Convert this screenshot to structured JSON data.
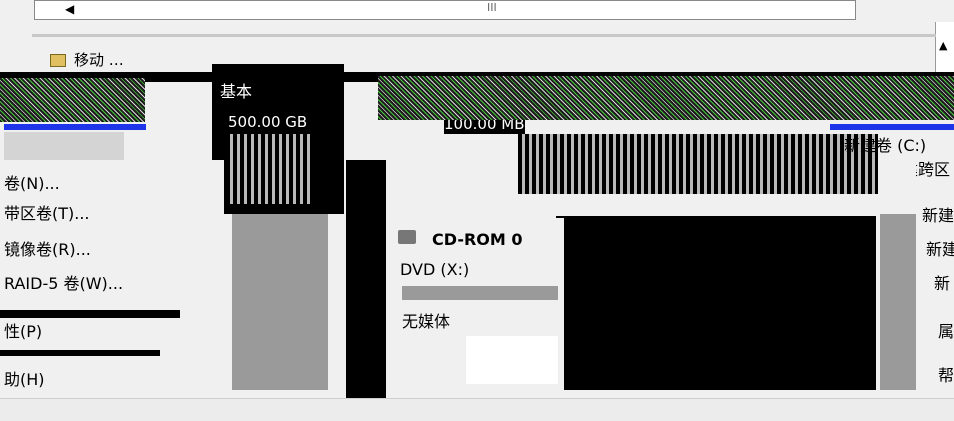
{
  "scrollbar": {
    "thumb_glyph": "III",
    "left_arrow": "◀",
    "up_arrow": "▲"
  },
  "toolbar": {
    "button_label": "移动 …"
  },
  "disk": {
    "type_label": "基本",
    "size_label": "500.00 GB",
    "partition_size": "100.00 MB",
    "partition_label": "新建卷 (C:)"
  },
  "context_menu_left": {
    "items": [
      "卷(N)...",
      "带区卷(T)...",
      "镜像卷(R)...",
      "RAID-5 卷(W)...",
      "性(P)",
      "助(H)"
    ]
  },
  "context_menu_right": {
    "items": [
      "新建跨区",
      "新建",
      "新建",
      "新",
      "属",
      "帮"
    ]
  },
  "cdrom": {
    "title": "CD-ROM 0",
    "drive": "DVD (X:)",
    "status": "无媒体"
  }
}
